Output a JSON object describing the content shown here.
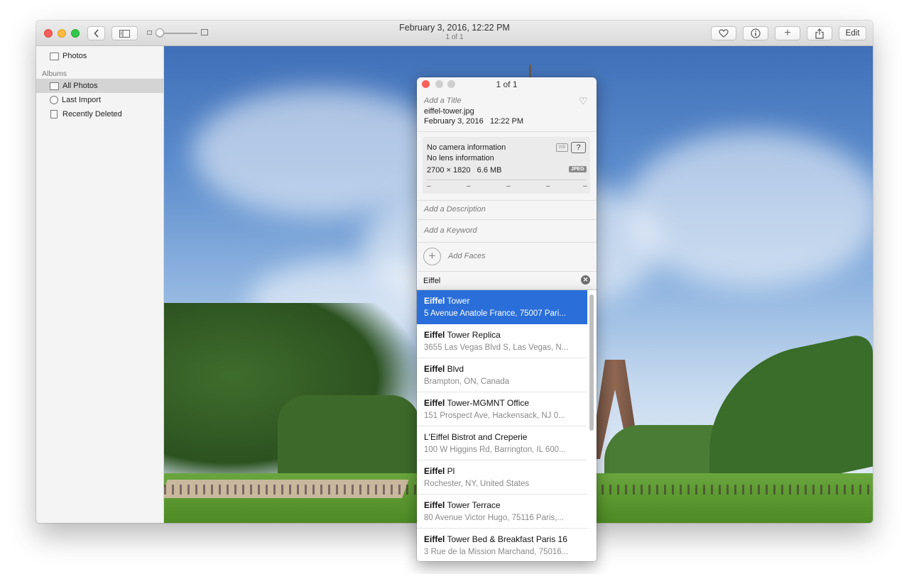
{
  "window": {
    "title": "February 3, 2016, 12:22 PM",
    "subtitle": "1 of 1",
    "toolbar": {
      "back_icon": "chevron-left-icon",
      "sidebar_icon": "sidebar-toggle-icon",
      "heart_icon": "heart-icon",
      "info_icon": "info-icon",
      "add_label": "+",
      "share_icon": "share-icon",
      "edit_label": "Edit"
    }
  },
  "sidebar": {
    "photos_label": "Photos",
    "albums_header": "Albums",
    "items": [
      {
        "label": "All Photos",
        "icon": "photos-stack-icon",
        "selected": true
      },
      {
        "label": "Last Import",
        "icon": "clock-icon"
      },
      {
        "label": "Recently Deleted",
        "icon": "trash-icon"
      }
    ]
  },
  "info": {
    "title": "1 of 1",
    "add_title_placeholder": "Add a Title",
    "filename": "eiffel-tower.jpg",
    "date": "February 3, 2016",
    "time": "12:22 PM",
    "camera": "No camera information",
    "lens": "No lens information",
    "dimensions": "2700 × 1820",
    "size": "6.6 MB",
    "format_badge": "JPEG",
    "dashes": [
      "–",
      "–",
      "–",
      "–",
      "–"
    ],
    "description_placeholder": "Add a Description",
    "keyword_placeholder": "Add a Keyword",
    "faces_label": "Add Faces",
    "location_value": "Eiffel"
  },
  "suggestions": [
    {
      "bold": "Eiffel",
      "rest": " Tower",
      "address": "5 Avenue Anatole France, 75007 Pari...",
      "selected": true
    },
    {
      "bold": "Eiffel",
      "rest": " Tower Replica",
      "address": "3655 Las Vegas Blvd S, Las Vegas, N..."
    },
    {
      "bold": "Eiffel",
      "rest": " Blvd",
      "address": "Brampton, ON, Canada"
    },
    {
      "bold": "Eiffel",
      "rest": " Tower-MGMNT Office",
      "address": "151 Prospect Ave, Hackensack, NJ  0..."
    },
    {
      "bold": "",
      "rest": "L'Eiffel Bistrot and Creperie",
      "address": "100 W Higgins Rd, Barrington, IL  600..."
    },
    {
      "bold": "Eiffel",
      "rest": " Pl",
      "address": "Rochester, NY, United States"
    },
    {
      "bold": "Eiffel",
      "rest": " Tower Terrace",
      "address": "80 Avenue Victor Hugo, 75116 Paris,..."
    },
    {
      "bold": "Eiffel",
      "rest": " Tower Bed & Breakfast Paris 16",
      "address": "3 Rue de la Mission Marchand, 75016..."
    }
  ]
}
